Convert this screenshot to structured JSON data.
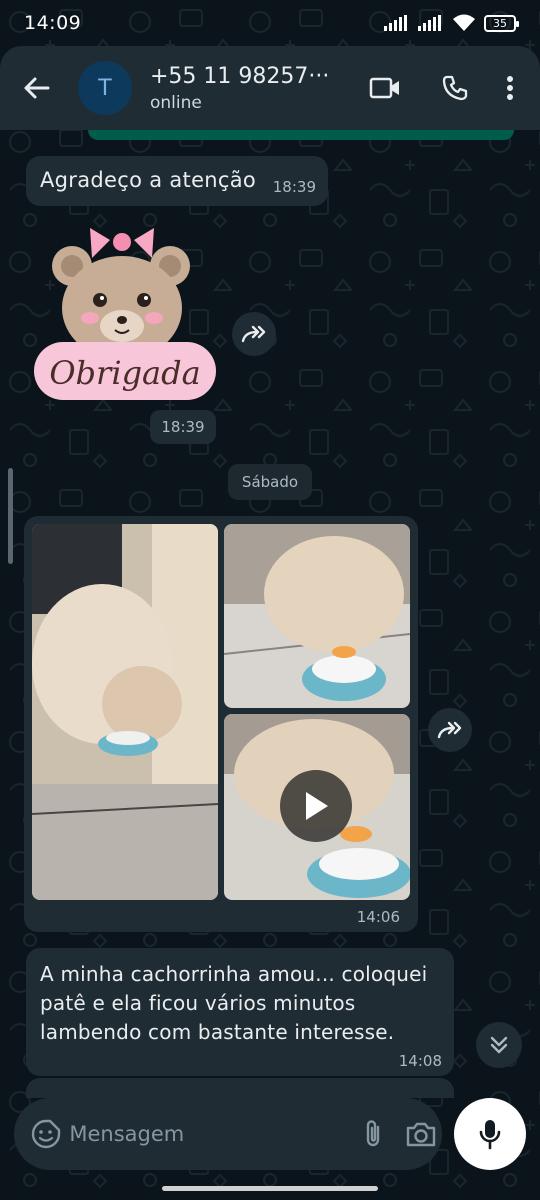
{
  "status_bar": {
    "time": "14:09",
    "battery": "35"
  },
  "header": {
    "avatar_letter": "T",
    "contact_name": "+55 11 98257···",
    "contact_status": "online"
  },
  "messages": {
    "thanks": {
      "text": "Agradeço a atenção",
      "time": "18:39"
    },
    "sticker": {
      "text": "Obrigada",
      "time": "18:39"
    },
    "date_separator": "Sábado",
    "media": {
      "time": "14:06"
    },
    "final": {
      "text": "A minha cachorrinha amou... coloquei patê e ela ficou vários minutos lambendo com bastante interesse.",
      "time": "14:08"
    }
  },
  "composer": {
    "placeholder": "Mensagem"
  },
  "colors": {
    "background": "#0b141a",
    "header": "#1f2c33",
    "incoming_bubble": "#202c33",
    "outgoing_bubble": "#005c4b",
    "sticker_pink": "#f7c6d8"
  }
}
